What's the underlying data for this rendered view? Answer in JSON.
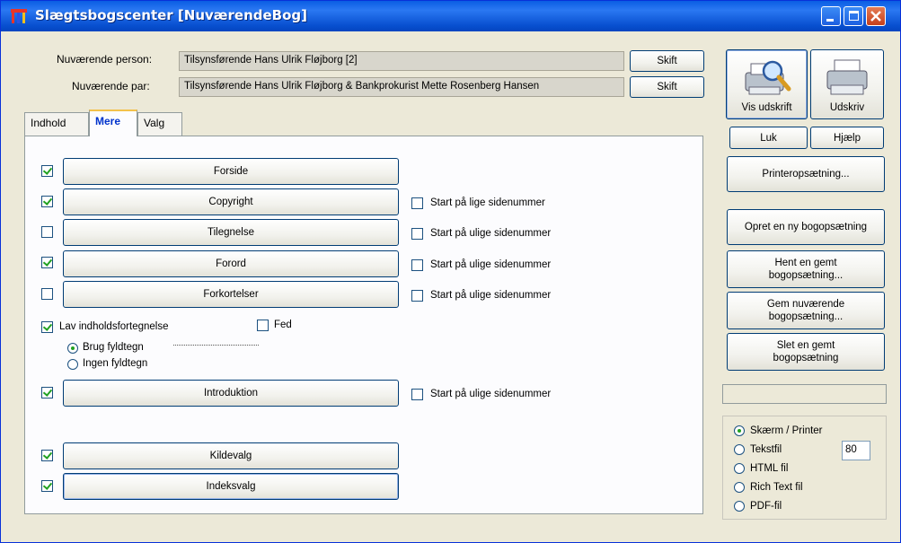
{
  "window": {
    "title": "Slægtsbogscenter [NuværendeBog]"
  },
  "header": {
    "person_label": "Nuværende person:",
    "person_value": "Tilsynsførende Hans Ulrik Fløjborg [2]",
    "par_label": "Nuværende par:",
    "par_value": "Tilsynsførende Hans Ulrik Fløjborg & Bankprokurist Mette Rosenberg Hansen",
    "skift_label": "Skift"
  },
  "tabs": [
    {
      "label": "Indhold"
    },
    {
      "label": "Mere"
    },
    {
      "label": "Valg"
    }
  ],
  "sections": {
    "forside": {
      "label": "Forside",
      "checked": true
    },
    "copyright": {
      "label": "Copyright",
      "checked": true,
      "start_label": "Start på lige sidenummer"
    },
    "tilegnelse": {
      "label": "Tilegnelse",
      "checked": false,
      "start_label": "Start på ulige sidenummer"
    },
    "forord": {
      "label": "Forord",
      "checked": true,
      "start_label": "Start på ulige sidenummer"
    },
    "forkortelser": {
      "label": "Forkortelser",
      "checked": false,
      "start_label": "Start på ulige sidenummer"
    },
    "introduktion": {
      "label": "Introduktion",
      "checked": true,
      "start_label": "Start på ulige sidenummer"
    },
    "kildevalg": {
      "label": "Kildevalg",
      "checked": true
    },
    "indeksvalg": {
      "label": "Indeksvalg",
      "checked": true
    }
  },
  "toc": {
    "lav_label": "Lav indholdsfortegnelse",
    "lav_checked": true,
    "fed_label": "Fed",
    "fed_checked": false,
    "brug_label": "Brug fyldtegn",
    "ingen_label": "Ingen fyldtegn",
    "selected": "brug"
  },
  "sidebar": {
    "vis_udskrift": "Vis udskrift",
    "udskriv": "Udskriv",
    "luk": "Luk",
    "hjaelp": "Hjælp",
    "printeropsaetning": "Printeropsætning...",
    "opret": "Opret en ny bogopsætning",
    "hent_line1": "Hent en gemt",
    "hent_line2": "bogopsætning...",
    "gem_line1": "Gem nuværende",
    "gem_line2": "bogopsætning...",
    "slet_line1": "Slet en gemt",
    "slet_line2": "bogopsætning"
  },
  "output": {
    "options": [
      {
        "label": "Skærm / Printer",
        "checked": true
      },
      {
        "label": "Tekstfil",
        "checked": false
      },
      {
        "label": "HTML fil",
        "checked": false
      },
      {
        "label": "Rich Text fil",
        "checked": false
      },
      {
        "label": "PDF-fil",
        "checked": false
      }
    ],
    "width_value": "80"
  }
}
